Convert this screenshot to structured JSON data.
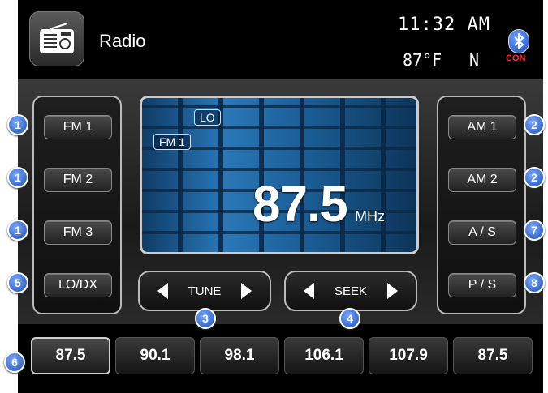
{
  "header": {
    "title": "Radio",
    "time": "11:32 AM",
    "temperature": "87°F",
    "direction": "N",
    "bluetooth_status": "CON",
    "bluetooth_symbol": "ʙ"
  },
  "left_bands": [
    {
      "label": "FM 1"
    },
    {
      "label": "FM 2"
    },
    {
      "label": "FM 3"
    },
    {
      "label": "LO/DX"
    }
  ],
  "right_bands": [
    {
      "label": "AM 1"
    },
    {
      "label": "AM 2"
    },
    {
      "label": "A / S"
    },
    {
      "label": "P / S"
    }
  ],
  "display": {
    "sensitivity": "LO",
    "band": "FM 1",
    "frequency": "87.5",
    "unit": "MHz"
  },
  "controls": {
    "tune_label": "TUNE",
    "seek_label": "SEEK"
  },
  "presets": [
    "87.5",
    "90.1",
    "98.1",
    "106.1",
    "107.9",
    "87.5"
  ],
  "callouts": {
    "fm1": "1",
    "fm2": "1",
    "fm3": "1",
    "lodx": "5",
    "am1": "2",
    "am2": "2",
    "as": "7",
    "ps": "8",
    "tune": "3",
    "seek": "4",
    "preset": "6"
  },
  "colors": {
    "callout": "#1e4fb0",
    "display_blue": "#2a78b8",
    "con_red": "#ff2b2b"
  }
}
